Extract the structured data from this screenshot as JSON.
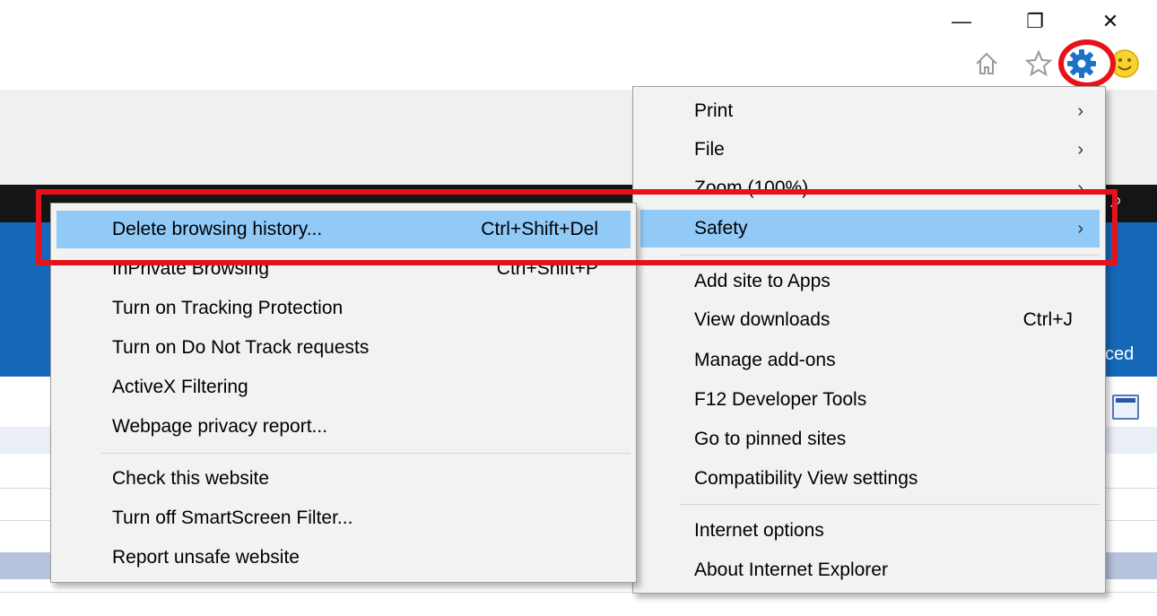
{
  "window": {
    "minimize_glyph": "—",
    "restore_glyph": "❐",
    "close_glyph": "✕"
  },
  "toolbar": {
    "icons": [
      "home-icon",
      "favorites-star-icon",
      "tools-gear-icon",
      "feedback-smiley-icon"
    ],
    "gear_color": "#1a73c9"
  },
  "background": {
    "cut_text": "ced"
  },
  "main_menu": {
    "items": [
      {
        "label": "Print",
        "shortcut": "",
        "arrow": "›"
      },
      {
        "label": "File",
        "shortcut": "",
        "arrow": "›"
      },
      {
        "label": "Zoom (100%)",
        "shortcut": "",
        "arrow": "›"
      },
      {
        "label": "Safety",
        "shortcut": "",
        "arrow": "›"
      },
      {
        "label": "Add site to Apps",
        "shortcut": "",
        "arrow": ""
      },
      {
        "label": "View downloads",
        "shortcut": "Ctrl+J",
        "arrow": ""
      },
      {
        "label": "Manage add-ons",
        "shortcut": "",
        "arrow": ""
      },
      {
        "label": "F12 Developer Tools",
        "shortcut": "",
        "arrow": ""
      },
      {
        "label": "Go to pinned sites",
        "shortcut": "",
        "arrow": ""
      },
      {
        "label": "Compatibility View settings",
        "shortcut": "",
        "arrow": ""
      },
      {
        "label": "Internet options",
        "shortcut": "",
        "arrow": ""
      },
      {
        "label": "About Internet Explorer",
        "shortcut": "",
        "arrow": ""
      }
    ],
    "highlighted": "Safety"
  },
  "safety_submenu": {
    "items": [
      {
        "label": "Delete browsing history...",
        "shortcut": "Ctrl+Shift+Del"
      },
      {
        "label": "InPrivate Browsing",
        "shortcut": "Ctrl+Shift+P"
      },
      {
        "label": "Turn on Tracking Protection",
        "shortcut": ""
      },
      {
        "label": "Turn on Do Not Track requests",
        "shortcut": ""
      },
      {
        "label": "ActiveX Filtering",
        "shortcut": ""
      },
      {
        "label": "Webpage privacy report...",
        "shortcut": ""
      },
      {
        "label": "Check this website",
        "shortcut": ""
      },
      {
        "label": "Turn off SmartScreen Filter...",
        "shortcut": ""
      },
      {
        "label": "Report unsafe website",
        "shortcut": ""
      }
    ],
    "highlighted": "Delete browsing history..."
  },
  "colors": {
    "highlight": "#91c9f7",
    "annotation_red": "#e8101a",
    "page_blue": "#1568b8",
    "menu_bg": "#f2f2f2"
  }
}
